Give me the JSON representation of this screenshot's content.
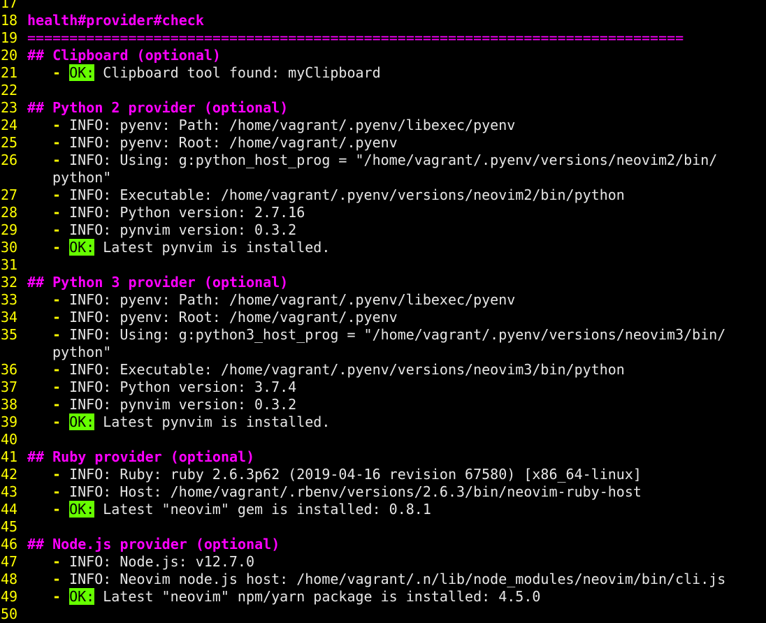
{
  "colors": {
    "background": "#000000",
    "line_number": "#ffff00",
    "header": "#ff00ff",
    "ok_background": "#66ff00",
    "text": "#e6e6e6"
  },
  "lines": [
    {
      "num": "17",
      "kind": "blank"
    },
    {
      "num": "18",
      "kind": "title",
      "text": "health#provider#check"
    },
    {
      "num": "19",
      "kind": "separator",
      "text": "=============================================================================="
    },
    {
      "num": "20",
      "kind": "section",
      "text": "## Clipboard (optional)"
    },
    {
      "num": "21",
      "kind": "ok",
      "text": "Clipboard tool found: myClipboard"
    },
    {
      "num": "22",
      "kind": "blank"
    },
    {
      "num": "23",
      "kind": "section",
      "text": "## Python 2 provider (optional)"
    },
    {
      "num": "24",
      "kind": "info",
      "text": "pyenv: Path: /home/vagrant/.pyenv/libexec/pyenv"
    },
    {
      "num": "25",
      "kind": "info",
      "text": "pyenv: Root: /home/vagrant/.pyenv"
    },
    {
      "num": "26",
      "kind": "info",
      "text": "Using: g:python_host_prog = \"/home/vagrant/.pyenv/versions/neovim2/bin/"
    },
    {
      "num": "",
      "kind": "continuation",
      "text": "python\""
    },
    {
      "num": "27",
      "kind": "info",
      "text": "Executable: /home/vagrant/.pyenv/versions/neovim2/bin/python"
    },
    {
      "num": "28",
      "kind": "info",
      "text": "Python version: 2.7.16"
    },
    {
      "num": "29",
      "kind": "info",
      "text": "pynvim version: 0.3.2"
    },
    {
      "num": "30",
      "kind": "ok",
      "text": "Latest pynvim is installed."
    },
    {
      "num": "31",
      "kind": "blank"
    },
    {
      "num": "32",
      "kind": "section",
      "text": "## Python 3 provider (optional)"
    },
    {
      "num": "33",
      "kind": "info",
      "text": "pyenv: Path: /home/vagrant/.pyenv/libexec/pyenv"
    },
    {
      "num": "34",
      "kind": "info",
      "text": "pyenv: Root: /home/vagrant/.pyenv"
    },
    {
      "num": "35",
      "kind": "info",
      "text": "Using: g:python3_host_prog = \"/home/vagrant/.pyenv/versions/neovim3/bin/"
    },
    {
      "num": "",
      "kind": "continuation",
      "text": "python\""
    },
    {
      "num": "36",
      "kind": "info",
      "text": "Executable: /home/vagrant/.pyenv/versions/neovim3/bin/python"
    },
    {
      "num": "37",
      "kind": "info",
      "text": "Python version: 3.7.4"
    },
    {
      "num": "38",
      "kind": "info",
      "text": "pynvim version: 0.3.2"
    },
    {
      "num": "39",
      "kind": "ok",
      "text": "Latest pynvim is installed."
    },
    {
      "num": "40",
      "kind": "blank"
    },
    {
      "num": "41",
      "kind": "section",
      "text": "## Ruby provider (optional)"
    },
    {
      "num": "42",
      "kind": "info",
      "text": "Ruby: ruby 2.6.3p62 (2019-04-16 revision 67580) [x86_64-linux]"
    },
    {
      "num": "43",
      "kind": "info",
      "text": "Host: /home/vagrant/.rbenv/versions/2.6.3/bin/neovim-ruby-host"
    },
    {
      "num": "44",
      "kind": "ok",
      "text": "Latest \"neovim\" gem is installed: 0.8.1"
    },
    {
      "num": "45",
      "kind": "blank"
    },
    {
      "num": "46",
      "kind": "section",
      "text": "## Node.js provider (optional)"
    },
    {
      "num": "47",
      "kind": "info",
      "text": "Node.js: v12.7.0"
    },
    {
      "num": "48",
      "kind": "info",
      "text": "Neovim node.js host: /home/vagrant/.n/lib/node_modules/neovim/bin/cli.js"
    },
    {
      "num": "49",
      "kind": "ok",
      "text": "Latest \"neovim\" npm/yarn package is installed: 4.5.0"
    },
    {
      "num": "50",
      "kind": "blank"
    }
  ],
  "labels": {
    "dash": "-",
    "info": "INFO:",
    "ok": "OK:"
  }
}
